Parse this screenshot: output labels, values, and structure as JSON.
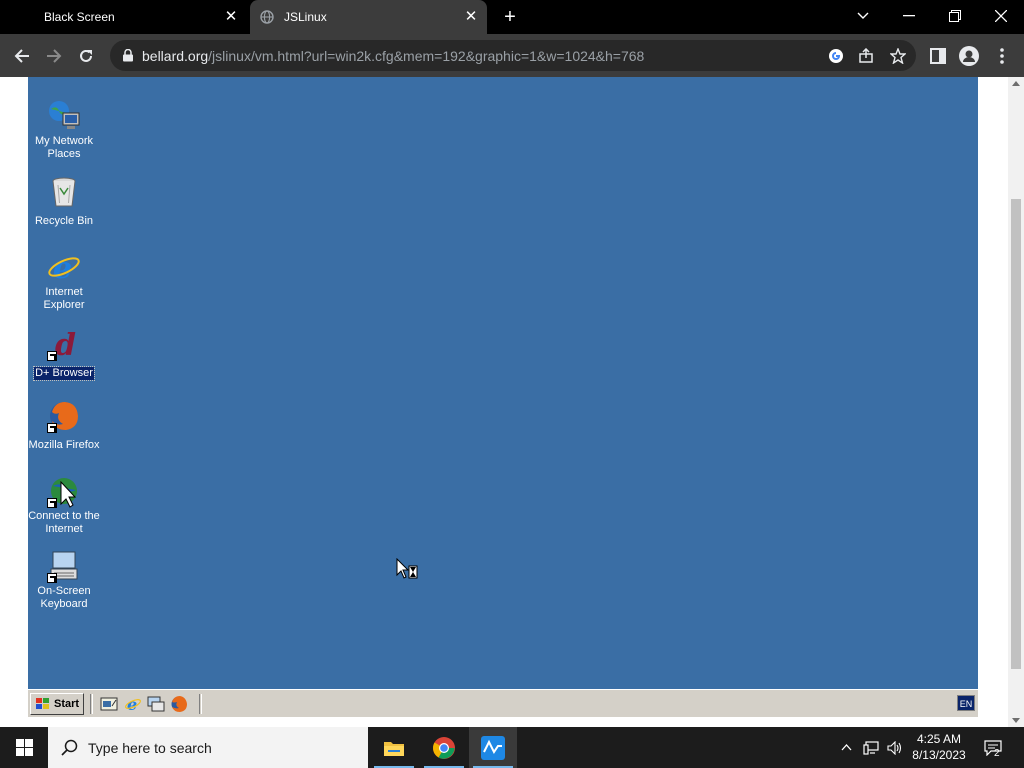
{
  "browser": {
    "tabs": [
      {
        "title": "Black Screen",
        "active": false
      },
      {
        "title": "JSLinux",
        "active": true
      }
    ],
    "url_host": "bellard.org",
    "url_path": "/jslinux/vm.html?url=win2k.cfg&mem=192&graphic=1&w=1024&h=768"
  },
  "desktop": {
    "background_color": "#3a6ea5",
    "icons": [
      {
        "label": "My Network Places",
        "icon": "network-places-icon",
        "selected": false
      },
      {
        "label": "Recycle Bin",
        "icon": "recycle-bin-icon",
        "selected": false
      },
      {
        "label": "Internet Explorer",
        "icon": "internet-explorer-icon",
        "selected": false
      },
      {
        "label": "D+ Browser",
        "icon": "dplus-browser-icon",
        "selected": true
      },
      {
        "label": "Mozilla Firefox",
        "icon": "firefox-icon",
        "selected": false
      },
      {
        "label": "Connect to the Internet",
        "icon": "connect-internet-icon",
        "selected": false
      },
      {
        "label": "On-Screen Keyboard",
        "icon": "onscreen-keyboard-icon",
        "selected": false
      }
    ]
  },
  "win2k_taskbar": {
    "start_label": "Start",
    "quick_launch": [
      "show-desktop-icon",
      "internet-explorer-icon",
      "desktop-switch-icon",
      "firefox-icon"
    ],
    "language": "EN"
  },
  "win10_taskbar": {
    "search_placeholder": "Type here to search",
    "apps": [
      "file-explorer-icon",
      "chrome-icon",
      "activity-app-icon"
    ],
    "time": "4:25 AM",
    "date": "8/13/2023",
    "notifications": "2"
  }
}
